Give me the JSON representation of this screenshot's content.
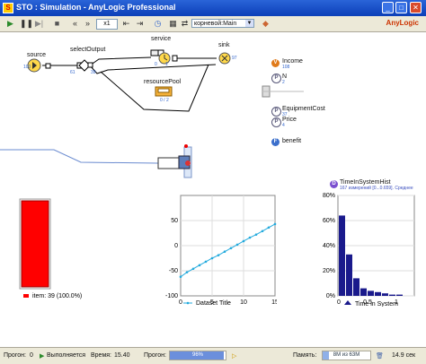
{
  "window": {
    "title": "STO : Simulation - AnyLogic Professional"
  },
  "toolbar": {
    "speed": "x1",
    "view": "корневой:Main",
    "logo": "AnyLogic"
  },
  "flowchart": {
    "source": "source",
    "select": "selectOutput",
    "service": "service",
    "sink": "sink",
    "pool": "resourcePool",
    "source_count": "100",
    "select_count_a": "39",
    "select_count_b": "61",
    "service_queue": "0",
    "service_delay": "1",
    "sink_count": "97",
    "pool_count": "0 / 2"
  },
  "variables": {
    "income_label": "Income",
    "income_value": "108",
    "n_label": "N",
    "n_value": "2",
    "equip_label": "EquipmentCost",
    "equip_value": "37",
    "price_label": "Price",
    "price_value": "4",
    "benefit_label": "benefit"
  },
  "chart_data": [
    {
      "type": "bar",
      "categories": [
        "item"
      ],
      "values": [
        100
      ],
      "ylim": [
        0,
        100
      ],
      "legend": "item: 39 (100.0%)"
    },
    {
      "type": "line",
      "x": [
        0,
        1,
        2,
        3,
        4,
        5,
        6,
        7,
        8,
        9,
        10,
        11,
        12,
        13,
        14,
        15
      ],
      "y": [
        -62,
        -53,
        -46,
        -39,
        -32,
        -25,
        -19,
        -12,
        -5,
        2,
        9,
        16,
        22,
        29,
        36,
        43
      ],
      "xlim": [
        0,
        15
      ],
      "ylim": [
        -100,
        100
      ],
      "xticks": [
        "0",
        "5",
        "10",
        "15"
      ],
      "yticks": [
        "50",
        "0",
        "-50",
        "-100"
      ],
      "legend": "Dataset Title"
    },
    {
      "type": "bar",
      "title": "TimeInSystemHist",
      "subtitle": "167 измерений [0...0.659]. Среднее",
      "values": [
        64,
        33,
        14,
        6,
        4,
        3,
        2,
        1,
        1,
        0
      ],
      "ylim": [
        0,
        80
      ],
      "yticks": [
        "80%",
        "60%",
        "40%",
        "20%",
        "0%"
      ],
      "xticks": [
        "0",
        "0.5",
        "1"
      ],
      "legend": "Time in System"
    }
  ],
  "status": {
    "run_label": "Прогон:",
    "run_value": "0",
    "state": "Выполняется",
    "time_label": "Время:",
    "time_value": "15.40",
    "progress_label": "Прогон:",
    "progress_value": "96%",
    "progress_fraction": 0.96,
    "memory_label": "Память:",
    "memory_value": "8M из 63M",
    "memory_fraction": 0.13,
    "fps": "14.9 сек"
  },
  "colors": {
    "titlebar": "#0b3fb8",
    "bar_red": "#ff0000",
    "hist": "#1a1a8c",
    "line": "#22aadd"
  }
}
